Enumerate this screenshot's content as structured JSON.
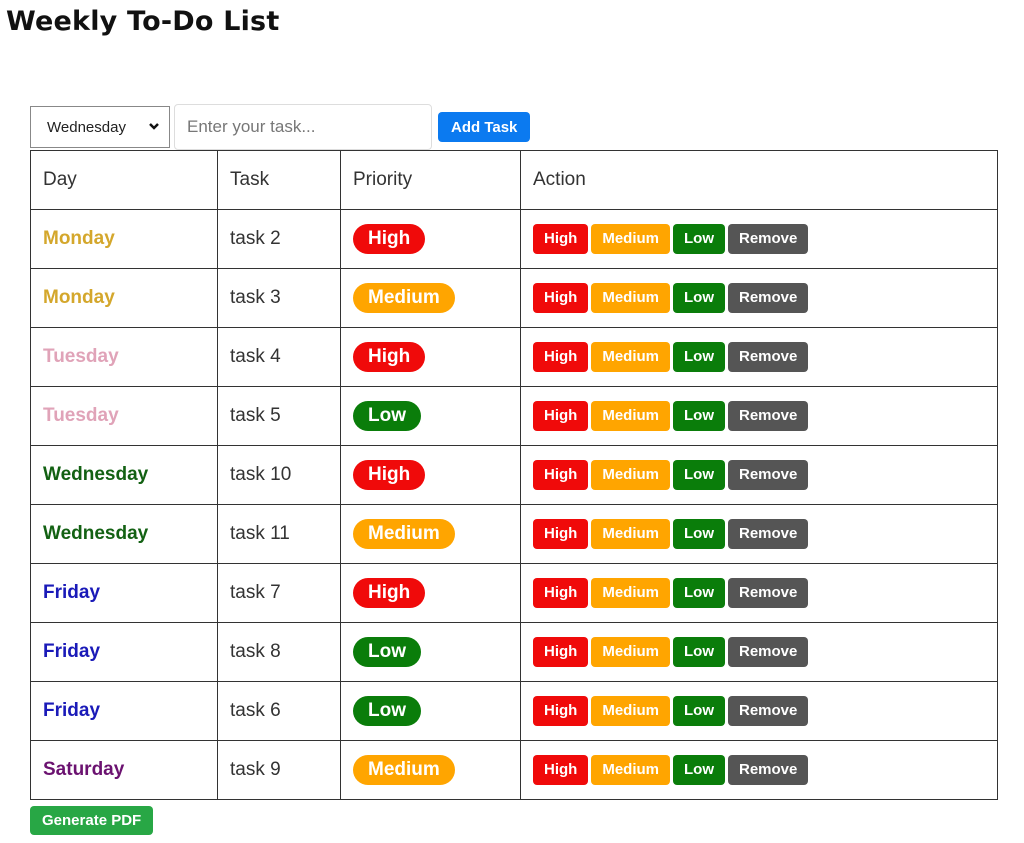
{
  "title": "Weekly To-Do List",
  "controls": {
    "day_select_value": "Wednesday",
    "task_placeholder": "Enter your task...",
    "add_label": "Add Task"
  },
  "table": {
    "headers": [
      "Day",
      "Task",
      "Priority",
      "Action"
    ],
    "rows": [
      {
        "day": "Monday",
        "day_color": "#d4a72c",
        "task": "task 2",
        "priority": "High"
      },
      {
        "day": "Monday",
        "day_color": "#d4a72c",
        "task": "task 3",
        "priority": "Medium"
      },
      {
        "day": "Tuesday",
        "day_color": "#e0a3b8",
        "task": "task 4",
        "priority": "High"
      },
      {
        "day": "Tuesday",
        "day_color": "#e0a3b8",
        "task": "task 5",
        "priority": "Low"
      },
      {
        "day": "Wednesday",
        "day_color": "#136113",
        "task": "task 10",
        "priority": "High"
      },
      {
        "day": "Wednesday",
        "day_color": "#136113",
        "task": "task 11",
        "priority": "Medium"
      },
      {
        "day": "Friday",
        "day_color": "#1a1ab8",
        "task": "task 7",
        "priority": "High"
      },
      {
        "day": "Friday",
        "day_color": "#1a1ab8",
        "task": "task 8",
        "priority": "Low"
      },
      {
        "day": "Friday",
        "day_color": "#1a1ab8",
        "task": "task 6",
        "priority": "Low"
      },
      {
        "day": "Saturday",
        "day_color": "#6b1270",
        "task": "task 9",
        "priority": "Medium"
      }
    ],
    "actions": {
      "high": "High",
      "medium": "Medium",
      "low": "Low",
      "remove": "Remove"
    }
  },
  "colors": {
    "High": "#f00a0a",
    "Medium": "#ffa500",
    "Low": "#0a7d0a",
    "remove": "#555555",
    "add_button": "#0b7af0",
    "pdf_button": "#28a745"
  },
  "footer": {
    "generate_pdf_label": "Generate PDF"
  }
}
